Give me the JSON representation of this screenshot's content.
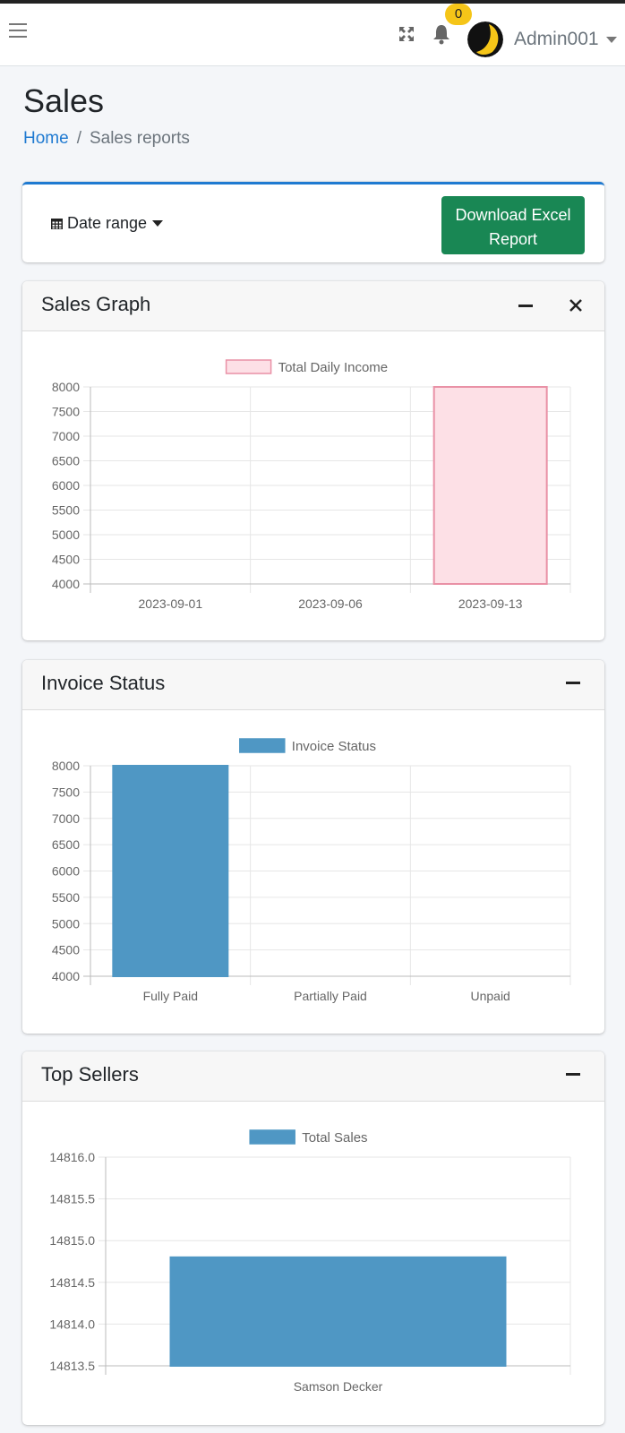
{
  "navbar": {
    "badge_count": "0",
    "user_name": "Admin001",
    "icons": [
      "menu-icon",
      "expand-icon",
      "bell-icon",
      "avatar-icon",
      "chevron-down-icon"
    ]
  },
  "page": {
    "title": "Sales",
    "breadcrumb": {
      "home": "Home",
      "separator": "/",
      "current": "Sales reports"
    }
  },
  "filters": {
    "date_range_label": "Date range",
    "download_button_label": "Download Excel Report"
  },
  "colors": {
    "accent": "#1f7ad1",
    "success_button": "#198754",
    "badge": "#f5c518",
    "income_bar_fill": "#fde0e6",
    "income_bar_border": "#e991a6",
    "status_bar": "#4f97c4"
  },
  "cards": {
    "sales_graph": {
      "title": "Sales Graph"
    },
    "invoice_status": {
      "title": "Invoice Status"
    },
    "top_sellers": {
      "title": "Top Sellers"
    }
  },
  "chart_data": [
    {
      "type": "bar",
      "legend": "Total Daily Income",
      "categories": [
        "2023-09-01",
        "2023-09-06",
        "2023-09-13"
      ],
      "values": [
        null,
        null,
        8000
      ],
      "ylim": [
        4000,
        8000
      ],
      "yticks": [
        "8000",
        "7500",
        "7000",
        "6500",
        "6000",
        "5500",
        "5000",
        "4500",
        "4000"
      ],
      "legend_position": "top",
      "grid": true
    },
    {
      "type": "bar",
      "legend": "Invoice Status",
      "categories": [
        "Fully Paid",
        "Partially Paid",
        "Unpaid"
      ],
      "values": [
        8000,
        null,
        null
      ],
      "ylim": [
        4000,
        8000
      ],
      "yticks": [
        "8000",
        "7500",
        "7000",
        "6500",
        "6000",
        "5500",
        "5000",
        "4500",
        "4000"
      ],
      "legend_position": "top",
      "grid": true
    },
    {
      "type": "bar",
      "legend": "Total Sales",
      "categories": [
        "Samson Decker"
      ],
      "values": [
        14814.8
      ],
      "ylim": [
        14813.5,
        14816.0
      ],
      "yticks": [
        "14816.0",
        "14815.5",
        "14815.0",
        "14814.5",
        "14814.0",
        "14813.5"
      ],
      "legend_position": "top",
      "grid": true
    }
  ]
}
